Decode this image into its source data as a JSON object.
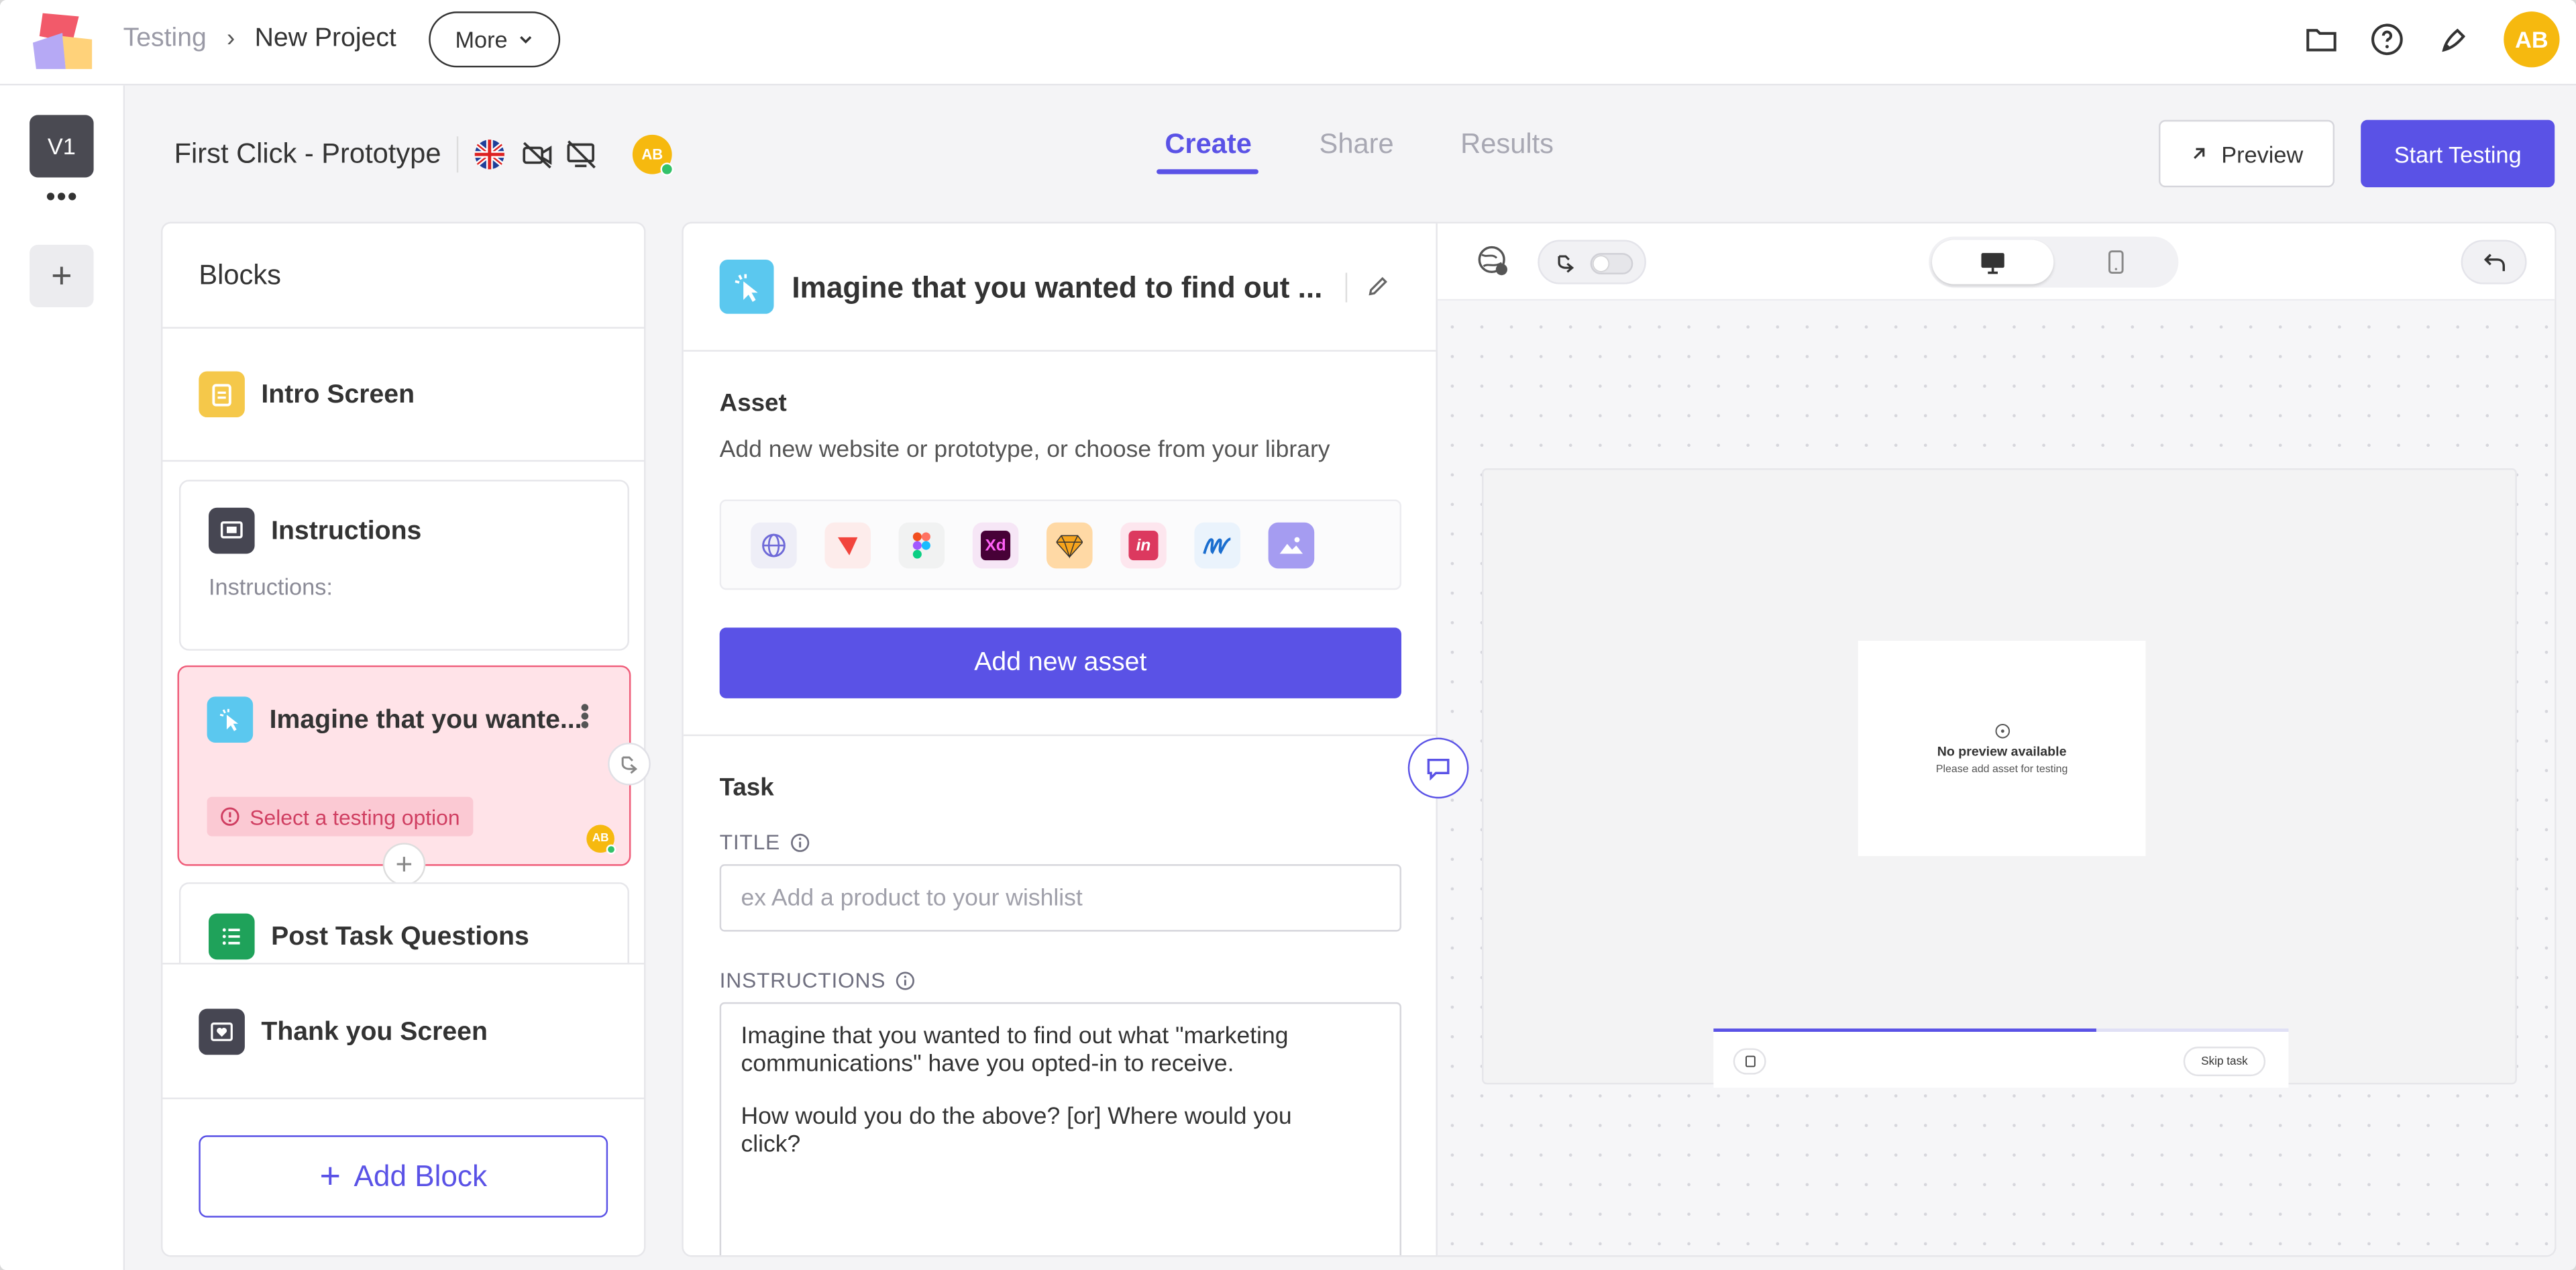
{
  "breadcrumb": {
    "parent": "Testing",
    "current": "New Project"
  },
  "top_actions": {
    "more_label": "More",
    "avatar_initials": "AB"
  },
  "rail": {
    "version_label": "V1",
    "dots": "•••",
    "add_label": "+"
  },
  "header": {
    "project_title": "First Click - Prototype",
    "avatar_initials": "AB",
    "tabs": [
      {
        "label": "Create",
        "active": true
      },
      {
        "label": "Share",
        "active": false
      },
      {
        "label": "Results",
        "active": false
      }
    ],
    "preview_label": "Preview",
    "start_label": "Start Testing"
  },
  "blocks": {
    "title": "Blocks",
    "items": [
      {
        "name": "Intro Screen"
      },
      {
        "name": "Instructions",
        "subtitle": "Instructions:"
      },
      {
        "name": "Imagine that you wante...",
        "warning": "Select a testing option",
        "avatar_initials": "AB"
      },
      {
        "name": "Post Task Questions"
      },
      {
        "name": "Thank you Screen"
      }
    ],
    "add_block_label": "Add Block"
  },
  "editor": {
    "block_title": "Imagine that you wanted to find out ...",
    "asset": {
      "heading": "Asset",
      "description": "Add new website or prototype, or choose from your library",
      "add_label": "Add new asset"
    },
    "task": {
      "heading": "Task",
      "title_label": "TITLE",
      "title_placeholder": "ex Add a product to your wishlist",
      "instructions_label": "INSTRUCTIONS",
      "instructions_line1": "Imagine that you wanted to find out what \"marketing communications\" have you opted-in to receive.",
      "instructions_line2": "How would you do the above? [or] Where would you click?"
    }
  },
  "preview": {
    "no_preview_title": "No preview available",
    "no_preview_subtitle": "Please add asset for testing",
    "skip_label": "Skip task"
  },
  "colors": {
    "accent": "#5a52e6",
    "warning": "#ef5c79",
    "avatar": "#f6b90f"
  }
}
